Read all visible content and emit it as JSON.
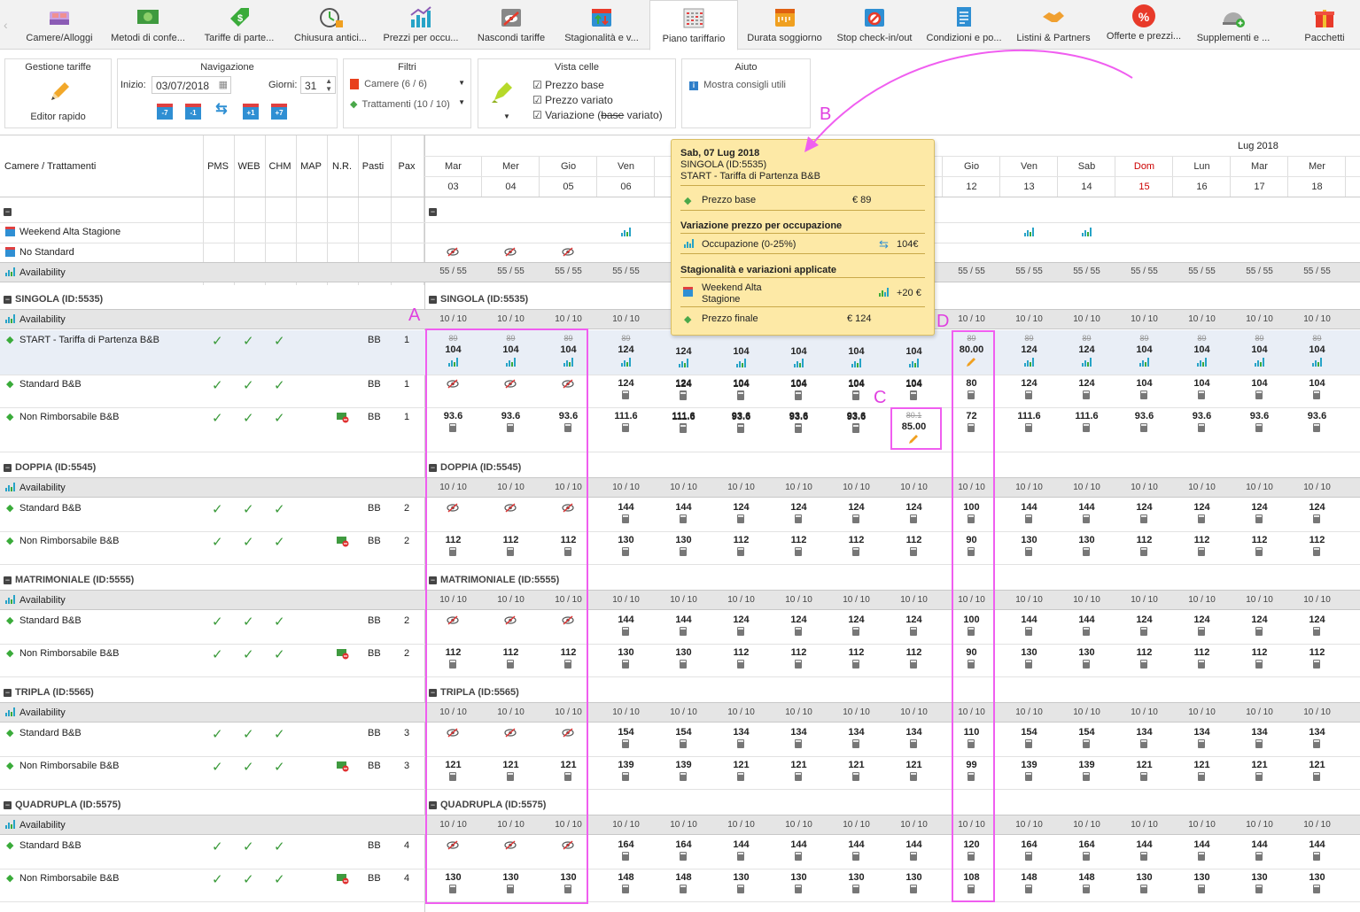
{
  "tabs": [
    {
      "label": "Camere/Alloggi",
      "icon": "bed-icon"
    },
    {
      "label": "Metodi di confe...",
      "icon": "money-icon"
    },
    {
      "label": "Tariffe di parte...",
      "icon": "price-tag-icon"
    },
    {
      "label": "Chiusura antici...",
      "icon": "stopwatch-icon"
    },
    {
      "label": "Prezzi per occu...",
      "icon": "bar-chart-icon"
    },
    {
      "label": "Nascondi tariffe",
      "icon": "hidden-calendar-icon"
    },
    {
      "label": "Stagionalità e v...",
      "icon": "seasonal-calendar-icon"
    },
    {
      "label": "Piano tariffario",
      "icon": "grid-calendar-icon",
      "active": true
    },
    {
      "label": "Durata soggiorno",
      "icon": "ruler-icon"
    },
    {
      "label": "Stop check-in/out",
      "icon": "stop-calendar-icon"
    },
    {
      "label": "Condizioni e po...",
      "icon": "document-icon"
    },
    {
      "label": "Listini & Partners",
      "icon": "handshake-icon"
    },
    {
      "label": "Offerte e prezzi...",
      "icon": "percent-badge-icon"
    },
    {
      "label": "Supplementi e ...",
      "icon": "cloche-plus-icon"
    },
    {
      "label": "Pacchetti",
      "icon": "gift-icon"
    }
  ],
  "panels": {
    "gestione": {
      "title": "Gestione tariffe",
      "label": "Editor rapido"
    },
    "navigazione": {
      "title": "Navigazione",
      "start_label": "Inizio:",
      "start_value": "03/07/2018",
      "days_label": "Giorni:",
      "days_value": "31",
      "steps": [
        "-7",
        "-1",
        "",
        "+1",
        "+7"
      ]
    },
    "filtri": {
      "title": "Filtri",
      "rooms": "Camere (6 / 6)",
      "treatments": "Trattamenti (10 / 10)"
    },
    "vista": {
      "title": "Vista celle",
      "opt1": "Prezzo base",
      "opt2": "Prezzo variato",
      "opt3_a": "Variazione (",
      "opt3_b": "base",
      "opt3_c": " variato)"
    },
    "aiuto": {
      "title": "Aiuto",
      "label": "Mostra consigli utili"
    }
  },
  "header": {
    "first_col": "Camere / Trattamenti",
    "cols": [
      "PMS",
      "WEB",
      "CHM",
      "MAP",
      "N.R.",
      "Pasti",
      "Pax"
    ],
    "month": "Lug 2018",
    "days": [
      {
        "dow": "Mar",
        "d": "03"
      },
      {
        "dow": "Mer",
        "d": "04"
      },
      {
        "dow": "Gio",
        "d": "05"
      },
      {
        "dow": "Ven",
        "d": "06"
      },
      {
        "dow": "",
        "d": ""
      },
      {
        "dow": "",
        "d": ""
      },
      {
        "dow": "",
        "d": ""
      },
      {
        "dow": "",
        "d": ""
      },
      {
        "dow": "",
        "d": ""
      },
      {
        "dow": "Gio",
        "d": "12"
      },
      {
        "dow": "Ven",
        "d": "13"
      },
      {
        "dow": "Sab",
        "d": "14"
      },
      {
        "dow": "Dom",
        "d": "15",
        "red": true
      },
      {
        "dow": "Lun",
        "d": "16"
      },
      {
        "dow": "Mar",
        "d": "17"
      },
      {
        "dow": "Mer",
        "d": "18"
      }
    ]
  },
  "top_rows": {
    "r1": "Weekend Alta Stagione",
    "r2": "No Standard",
    "r3": "Availability",
    "avail": "55 / 55"
  },
  "groups": [
    {
      "name": "SINGOLA (ID:5535)",
      "avail": "10 / 10",
      "rates": [
        {
          "name": "START - Tariffa di Partenza B&B",
          "meals": "BB",
          "pax": "1",
          "nr": false,
          "kind": "start",
          "old": "89",
          "vals": [
            "104",
            "104",
            "104",
            "124",
            "124",
            "104",
            "104",
            "104",
            "104",
            "80.00",
            "124",
            "124",
            "104",
            "104",
            "104",
            "104"
          ]
        },
        {
          "name": "Standard B&B",
          "meals": "BB",
          "pax": "1",
          "nr": false,
          "kind": "std",
          "vals": [
            "H",
            "H",
            "H",
            "124",
            "124",
            "104",
            "104",
            "104",
            "104",
            "80",
            "124",
            "124",
            "104",
            "104",
            "104",
            "104"
          ]
        },
        {
          "name": "Non Rimborsabile B&B",
          "meals": "BB",
          "pax": "1",
          "nr": true,
          "kind": "nr",
          "vals": [
            "93.6",
            "93.6",
            "93.6",
            "111.6",
            "111.6",
            "93.6",
            "93.6",
            "93.6",
            "85.00",
            "72",
            "111.6",
            "111.6",
            "93.6",
            "93.6",
            "93.6",
            "93.6"
          ],
          "edited_old": "80.1"
        }
      ]
    },
    {
      "name": "DOPPIA (ID:5545)",
      "avail": "10 / 10",
      "rates": [
        {
          "name": "Standard B&B",
          "meals": "BB",
          "pax": "2",
          "nr": false,
          "kind": "std",
          "vals": [
            "H",
            "H",
            "H",
            "144",
            "144",
            "124",
            "124",
            "124",
            "124",
            "100",
            "144",
            "144",
            "124",
            "124",
            "124",
            "124"
          ]
        },
        {
          "name": "Non Rimborsabile B&B",
          "meals": "BB",
          "pax": "2",
          "nr": true,
          "kind": "nr",
          "vals": [
            "112",
            "112",
            "112",
            "130",
            "130",
            "112",
            "112",
            "112",
            "112",
            "90",
            "130",
            "130",
            "112",
            "112",
            "112",
            "112"
          ]
        }
      ]
    },
    {
      "name": "MATRIMONIALE (ID:5555)",
      "avail": "10 / 10",
      "rates": [
        {
          "name": "Standard B&B",
          "meals": "BB",
          "pax": "2",
          "nr": false,
          "kind": "std",
          "vals": [
            "H",
            "H",
            "H",
            "144",
            "144",
            "124",
            "124",
            "124",
            "124",
            "100",
            "144",
            "144",
            "124",
            "124",
            "124",
            "124"
          ]
        },
        {
          "name": "Non Rimborsabile B&B",
          "meals": "BB",
          "pax": "2",
          "nr": true,
          "kind": "nr",
          "vals": [
            "112",
            "112",
            "112",
            "130",
            "130",
            "112",
            "112",
            "112",
            "112",
            "90",
            "130",
            "130",
            "112",
            "112",
            "112",
            "112"
          ]
        }
      ]
    },
    {
      "name": "TRIPLA (ID:5565)",
      "avail": "10 / 10",
      "rates": [
        {
          "name": "Standard B&B",
          "meals": "BB",
          "pax": "3",
          "nr": false,
          "kind": "std",
          "vals": [
            "H",
            "H",
            "H",
            "154",
            "154",
            "134",
            "134",
            "134",
            "134",
            "110",
            "154",
            "154",
            "134",
            "134",
            "134",
            "134"
          ]
        },
        {
          "name": "Non Rimborsabile B&B",
          "meals": "BB",
          "pax": "3",
          "nr": true,
          "kind": "nr",
          "vals": [
            "121",
            "121",
            "121",
            "139",
            "139",
            "121",
            "121",
            "121",
            "121",
            "99",
            "139",
            "139",
            "121",
            "121",
            "121",
            "121"
          ]
        }
      ]
    },
    {
      "name": "QUADRUPLA (ID:5575)",
      "avail": "10 / 10",
      "rates": [
        {
          "name": "Standard B&B",
          "meals": "BB",
          "pax": "4",
          "nr": false,
          "kind": "std",
          "vals": [
            "H",
            "H",
            "H",
            "164",
            "164",
            "144",
            "144",
            "144",
            "144",
            "120",
            "164",
            "164",
            "144",
            "144",
            "144",
            "144"
          ]
        },
        {
          "name": "Non Rimborsabile B&B",
          "meals": "BB",
          "pax": "4",
          "nr": true,
          "kind": "nr",
          "vals": [
            "130",
            "130",
            "130",
            "148",
            "148",
            "130",
            "130",
            "130",
            "130",
            "108",
            "148",
            "148",
            "130",
            "130",
            "130",
            "130"
          ]
        }
      ]
    }
  ],
  "tooltip": {
    "date": "Sab, 07 Lug 2018",
    "room": "SINGOLA (ID:5535)",
    "rate": "START - Tariffa di Partenza B&B",
    "base_label": "Prezzo base",
    "base_value": "€ 89",
    "occ_title": "Variazione prezzo per occupazione",
    "occ_label": "Occupazione (0-25%)",
    "occ_value": "104€",
    "season_title": "Stagionalità e variazioni applicate",
    "season_label_1": "Weekend Alta",
    "season_label_2": "Stagione",
    "season_value": "+20 €",
    "final_label": "Prezzo finale",
    "final_value": "€ 124"
  },
  "annotations": {
    "a": "A",
    "b": "B",
    "c": "C",
    "d": "D"
  },
  "colors": {
    "accent": "#27a3c7",
    "check": "#3a9a3a",
    "annotation": "#f05ef0",
    "tooltip_bg": "#fde9a6",
    "sunday": "#cc0000"
  }
}
